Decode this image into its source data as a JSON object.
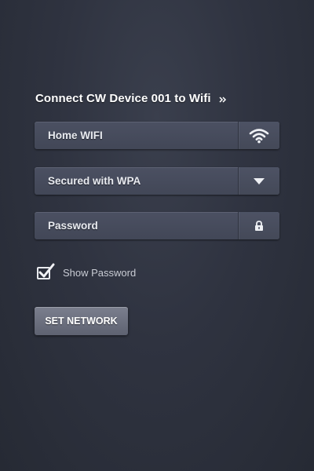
{
  "title": "Connect CW Device 001 to Wifi",
  "title_icon": "double-chevron-right-icon",
  "fields": {
    "network": {
      "value": "Home WIFI",
      "icon": "wifi-icon"
    },
    "security": {
      "value": "Secured with WPA",
      "icon": "dropdown-arrow-icon"
    },
    "password": {
      "placeholder": "Password",
      "icon": "lock-icon"
    }
  },
  "show_password": {
    "label": "Show Password",
    "checked": true
  },
  "submit": {
    "label": "SET NETWORK"
  },
  "colors": {
    "background": "#2f3340",
    "field": "#464b5b",
    "text": "#e9ebf0",
    "button": "#6c7080"
  }
}
